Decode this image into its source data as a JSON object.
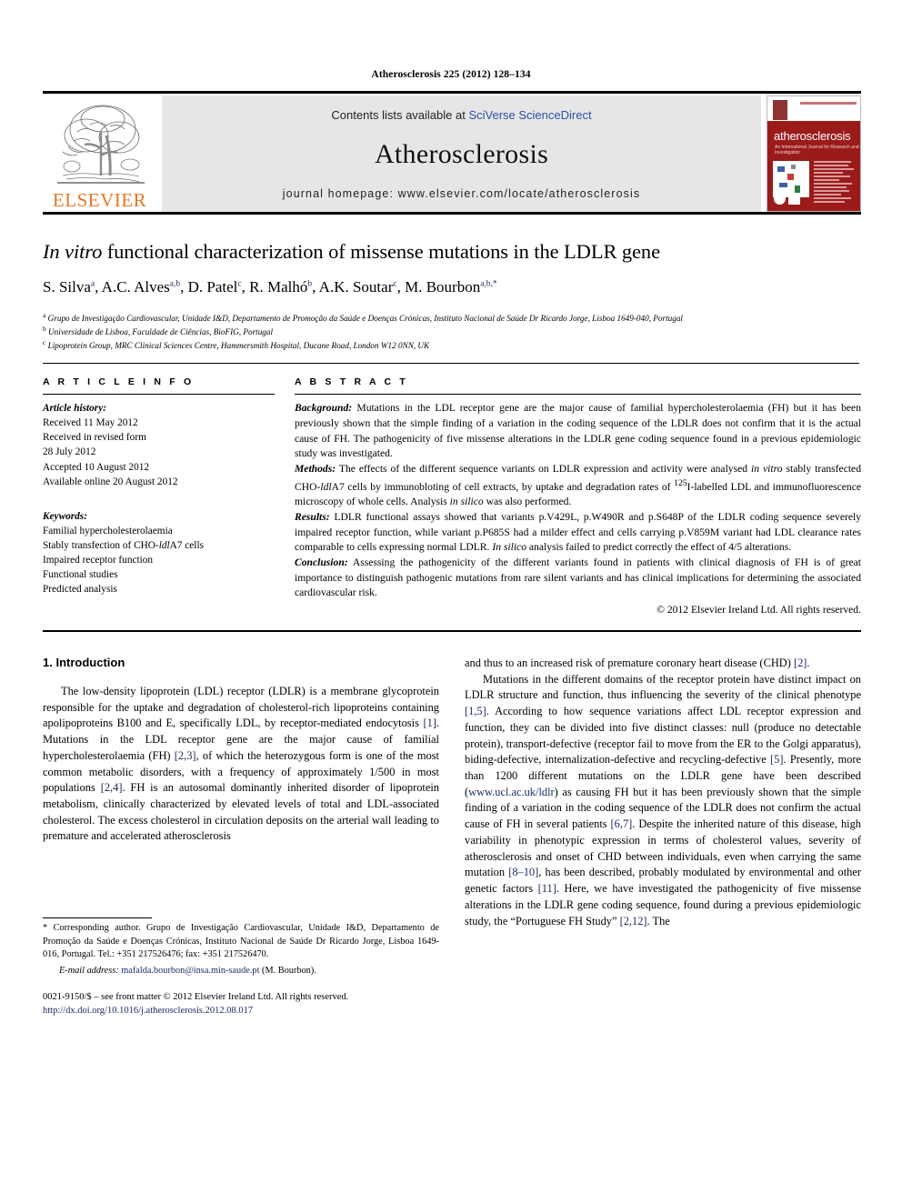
{
  "running_head": "Atherosclerosis 225 (2012) 128–134",
  "masthead": {
    "publisher_logo_text": "ELSEVIER",
    "contents_prefix": "Contents lists available at ",
    "contents_link": "SciVerse ScienceDirect",
    "journal_name": "Atherosclerosis",
    "homepage": "journal homepage: www.elsevier.com/locate/atherosclerosis",
    "cover": {
      "title": "atherosclerosis",
      "subtitle": "An International Journal for Research and Investigation"
    },
    "accent_color": "#E87722",
    "link_color": "#2b50a3",
    "cover_color": "#9b1b1b"
  },
  "article": {
    "title_italic_lead": "In vitro",
    "title_rest": " functional characterization of missense mutations in the LDLR gene",
    "authors": "S. Silva a, A.C. Alves a,b, D. Patel c, R. Malhó b, A.K. Soutar c, M. Bourbon a,b,*",
    "affiliations": [
      "a Grupo de Investigação Cardiovascular, Unidade I&D, Departamento de Promoção da Saúde e Doenças Crónicas, Instituto Nacional de Saúde Dr Ricardo Jorge, Lisboa 1649-040, Portugal",
      "b Universidade de Lisboa, Faculdade de Ciências, BioFIG, Portugal",
      "c Lipoprotein Group, MRC Clinical Sciences Centre, Hammersmith Hospital, Ducane Road, London W12 0NN, UK"
    ]
  },
  "article_info": {
    "heading": "A R T I C L E   I N F O",
    "history_label": "Article history:",
    "history": [
      "Received 11 May 2012",
      "Received in revised form",
      "28 July 2012",
      "Accepted 10 August 2012",
      "Available online 20 August 2012"
    ],
    "keywords_label": "Keywords:",
    "keywords": [
      "Familial hypercholesterolaemia",
      "Stably transfection of CHO-ldlA7 cells",
      "Impaired receptor function",
      "Functional studies",
      "Predicted analysis"
    ]
  },
  "abstract": {
    "heading": "A B S T R A C T",
    "background_label": "Background:",
    "background": " Mutations in the LDL receptor gene are the major cause of familial hypercholesterolaemia (FH) but it has been previously shown that the simple finding of a variation in the coding sequence of the LDLR does not confirm that it is the actual cause of FH. The pathogenicity of five missense alterations in the LDLR gene coding sequence found in a previous epidemiologic study was investigated.",
    "methods_label": "Methods:",
    "methods": " The effects of the different sequence variants on LDLR expression and activity were analysed in vitro stably transfected CHO-ldlA7 cells by immunobloting of cell extracts, by uptake and degradation rates of 125I-labelled LDL and immunofluorescence microscopy of whole cells. Analysis in silico was also performed.",
    "results_label": "Results:",
    "results": " LDLR functional assays showed that variants p.V429L, p.W490R and p.S648P of the LDLR coding sequence severely impaired receptor function, while variant p.P685S had a milder effect and cells carrying p.V859M variant had LDL clearance rates comparable to cells expressing normal LDLR. In silico analysis failed to predict correctly the effect of 4/5 alterations.",
    "conclusion_label": "Conclusion:",
    "conclusion": " Assessing the pathogenicity of the different variants found in patients with clinical diagnosis of FH is of great importance to distinguish pathogenic mutations from rare silent variants and has clinical implications for determining the associated cardiovascular risk.",
    "copyright": "© 2012 Elsevier Ireland Ltd. All rights reserved."
  },
  "body": {
    "section_heading": "1. Introduction",
    "left_paragraph_1": "The low-density lipoprotein (LDL) receptor (LDLR) is a membrane glycoprotein responsible for the uptake and degradation of cholesterol-rich lipoproteins containing apolipoproteins B100 and E, specifically LDL, by receptor-mediated endocytosis [1]. Mutations in the LDL receptor gene are the major cause of familial hypercholesterolaemia (FH) [2,3], of which the heterozygous form is one of the most common metabolic disorders, with a frequency of approximately 1/500 in most populations [2,4]. FH is an autosomal dominantly inherited disorder of lipoprotein metabolism, clinically characterized by elevated levels of total and LDL-associated cholesterol. The excess cholesterol in circulation deposits on the arterial wall leading to premature and accelerated atherosclerosis",
    "right_paragraph_1": "and thus to an increased risk of premature coronary heart disease (CHD) [2].",
    "right_paragraph_2": "Mutations in the different domains of the receptor protein have distinct impact on LDLR structure and function, thus influencing the severity of the clinical phenotype [1,5]. According to how sequence variations affect LDL receptor expression and function, they can be divided into five distinct classes: null (produce no detectable protein), transport-defective (receptor fail to move from the ER to the Golgi apparatus), biding-defective, internalization-defective and recycling-defective [5]. Presently, more than 1200 different mutations on the LDLR gene have been described (www.ucl.ac.uk/ldlr) as causing FH but it has been previously shown that the simple finding of a variation in the coding sequence of the LDLR does not confirm the actual cause of FH in several patients [6,7]. Despite the inherited nature of this disease, high variability in phenotypic expression in terms of cholesterol values, severity of atherosclerosis and onset of CHD between individuals, even when carrying the same mutation [8–10], has been described, probably modulated by environmental and other genetic factors [11]. Here, we have investigated the pathogenicity of five missense alterations in the LDLR gene coding sequence, found during a previous epidemiologic study, the “Portuguese FH Study” [2,12]. The"
  },
  "footnote": {
    "corresponding": "* Corresponding author. Grupo de Investigação Cardiovascular, Unidade I&D, Departamento de Promoção da Saúde e Doenças Crónicas, Instituto Nacional de Saúde Dr Ricardo Jorge, Lisboa 1649-016, Portugal. Tel.: +351 217526476; fax: +351 217526470.",
    "email_label": "E-mail address:",
    "email": "mafalda.bourbon@insa.min-saude.pt",
    "email_suffix": " (M. Bourbon).",
    "issn_line": "0021-9150/$ – see front matter © 2012 Elsevier Ireland Ltd. All rights reserved.",
    "doi": "http://dx.doi.org/10.1016/j.atherosclerosis.2012.08.017"
  }
}
